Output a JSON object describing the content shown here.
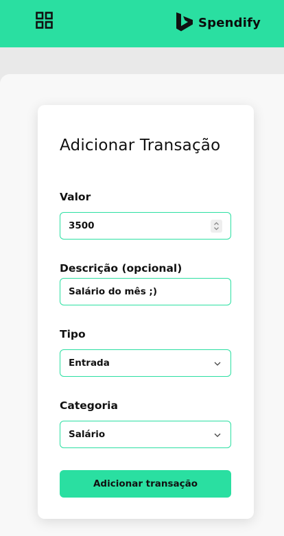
{
  "header": {
    "menu_icon": "grid-icon",
    "brand_icon": "spendify-logo",
    "brand_name": "Spendify",
    "accent_color": "#2adfa1"
  },
  "form": {
    "title": "Adicionar Transação",
    "valor": {
      "label": "Valor",
      "value": "3500"
    },
    "descricao": {
      "label": "Descrição (opcional)",
      "value": "Salário do mês ;)"
    },
    "tipo": {
      "label": "Tipo",
      "selected": "Entrada"
    },
    "categoria": {
      "label": "Categoria",
      "selected": "Salário"
    },
    "submit_label": "Adicionar transação"
  }
}
